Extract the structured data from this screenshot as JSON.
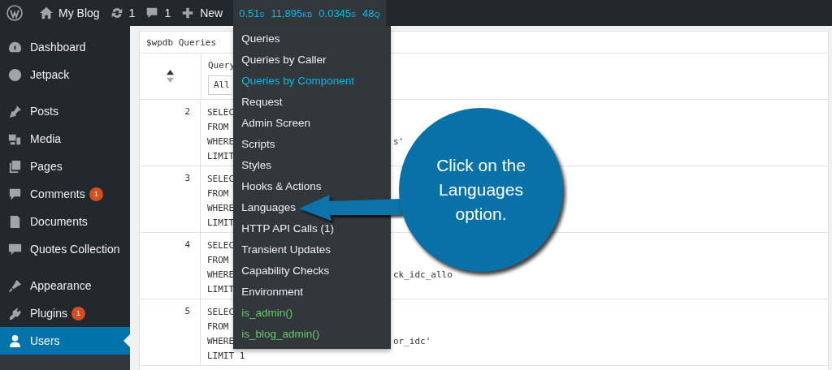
{
  "topbar": {
    "site": "My Blog",
    "updates": "1",
    "comments": "1",
    "new": "New",
    "stats": [
      "0.51s",
      "11,895kb",
      "0.0345s",
      "48q"
    ]
  },
  "sidebar": [
    {
      "label": "Dashboard",
      "selected": false,
      "separator_before": false
    },
    {
      "label": "Jetpack",
      "selected": false,
      "separator_before": false
    },
    {
      "label": "Posts",
      "selected": false,
      "separator_before": true
    },
    {
      "label": "Media",
      "selected": false,
      "separator_before": false
    },
    {
      "label": "Pages",
      "selected": false,
      "separator_before": false
    },
    {
      "label": "Comments",
      "selected": false,
      "separator_before": false,
      "badge": "1"
    },
    {
      "label": "Documents",
      "selected": false,
      "separator_before": false
    },
    {
      "label": "Quotes Collection",
      "selected": false,
      "separator_before": false
    },
    {
      "label": "Appearance",
      "selected": false,
      "separator_before": true
    },
    {
      "label": "Plugins",
      "selected": false,
      "separator_before": false,
      "badge": "1"
    },
    {
      "label": "Users",
      "selected": true,
      "separator_before": false
    }
  ],
  "panel": {
    "title": "$wpdb Queries",
    "column": "Query",
    "filter": "All",
    "rows": [
      {
        "number": "2",
        "lines": [
          {
            "left": "SELEC"
          },
          {
            "left": "FROM"
          },
          {
            "left": "WHERE",
            "right": "s'"
          },
          {
            "left": "LIMIT"
          }
        ]
      },
      {
        "number": "3",
        "lines": [
          {
            "left": "SELEC"
          },
          {
            "left": "FROM"
          },
          {
            "left": "WHERE"
          },
          {
            "left": "LIMIT"
          }
        ]
      },
      {
        "number": "4",
        "lines": [
          {
            "left": "SELEC"
          },
          {
            "left": "FROM"
          },
          {
            "left": "WHERE",
            "right": "ck_idc_allo"
          },
          {
            "left": "LIMIT"
          }
        ]
      },
      {
        "number": "5",
        "lines": [
          {
            "left": "SELEC"
          },
          {
            "left": "FROM"
          },
          {
            "left": "WHERE",
            "right": "or_idc'"
          },
          {
            "left": "LIMIT 1"
          }
        ]
      }
    ]
  },
  "menu": [
    {
      "label": "Queries",
      "kind": "panel",
      "selected": false
    },
    {
      "label": "Queries by Caller",
      "kind": "panel",
      "selected": false
    },
    {
      "label": "Queries by Component",
      "kind": "panel",
      "selected": true
    },
    {
      "label": "Request",
      "kind": "panel",
      "selected": false
    },
    {
      "label": "Admin Screen",
      "kind": "panel",
      "selected": false
    },
    {
      "label": "Scripts",
      "kind": "panel",
      "selected": false
    },
    {
      "label": "Styles",
      "kind": "panel",
      "selected": false
    },
    {
      "label": "Hooks & Actions",
      "kind": "panel",
      "selected": false
    },
    {
      "label": "Languages",
      "kind": "panel",
      "selected": false
    },
    {
      "label": "HTTP API Calls (1)",
      "kind": "panel",
      "selected": false
    },
    {
      "label": "Transient Updates",
      "kind": "panel",
      "selected": false
    },
    {
      "label": "Capability Checks",
      "kind": "panel",
      "selected": false
    },
    {
      "label": "Environment",
      "kind": "panel",
      "selected": false
    },
    {
      "label": "is_admin()",
      "kind": "condition",
      "selected": false
    },
    {
      "label": "is_blog_admin()",
      "kind": "condition",
      "selected": false
    }
  ],
  "callout": {
    "text": "Click on the Languages option."
  }
}
